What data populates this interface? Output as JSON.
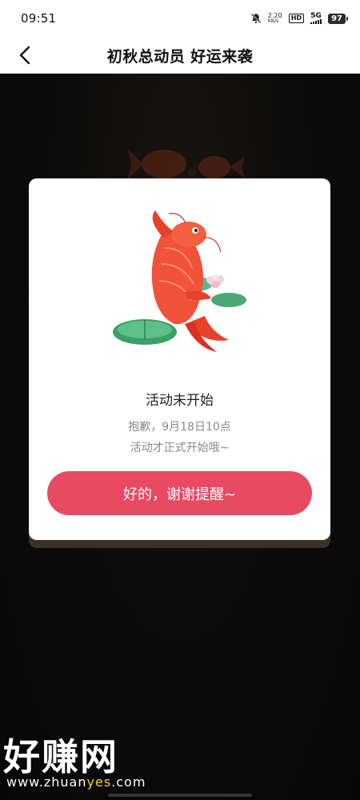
{
  "status_bar": {
    "time": "09:51",
    "net_speed": "2.20",
    "net_unit": "KB/s",
    "hd": "HD",
    "signal": "5G",
    "battery": "97"
  },
  "header": {
    "title": "初秋总动员 好运来袭"
  },
  "dialog": {
    "title": "活动未开始",
    "message_line1": "抱歉，9月18日10点",
    "message_line2": "活动才正式开始哦~",
    "confirm_label": "好的，谢谢提醒~"
  },
  "watermark": {
    "title": "好赚网",
    "url_prefix": "www.zhuan",
    "url_accent": "yes",
    "url_suffix": ".com"
  },
  "colors": {
    "accent": "#e84a63",
    "overlay": "#0b0b0b",
    "fish": "#f0533a"
  }
}
